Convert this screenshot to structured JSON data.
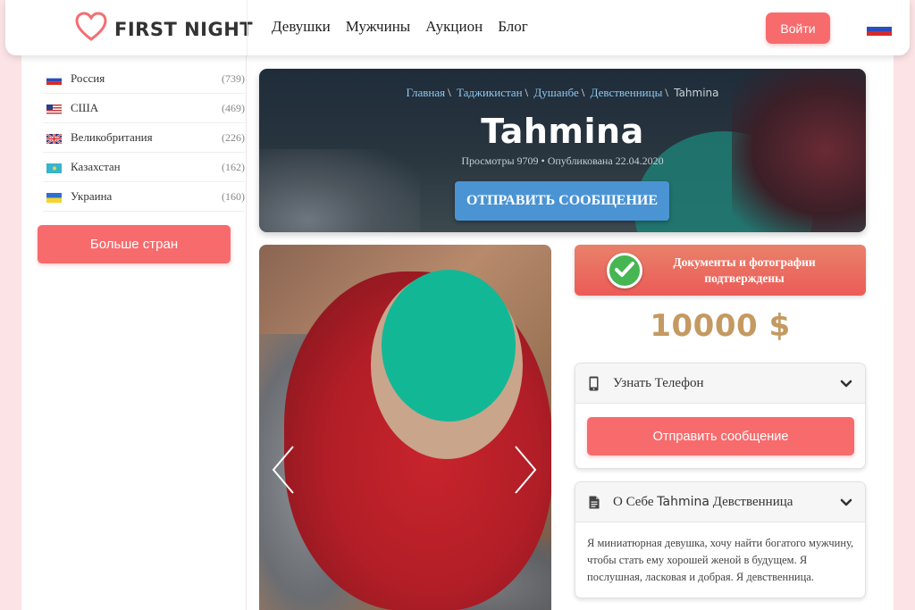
{
  "header": {
    "logo_text": "FIRST NIGHT",
    "nav": [
      "Девушки",
      "Мужчины",
      "Аукцион",
      "Блог"
    ],
    "login_label": "Войти",
    "language_flag": "russia-flag-icon"
  },
  "sidebar": {
    "countries": [
      {
        "name": "Россия",
        "count": "(739)",
        "flag": "russia-flag-icon"
      },
      {
        "name": "США",
        "count": "(469)",
        "flag": "usa-flag-icon"
      },
      {
        "name": "Великобритания",
        "count": "(226)",
        "flag": "uk-flag-icon"
      },
      {
        "name": "Казахстан",
        "count": "(162)",
        "flag": "kazakhstan-flag-icon"
      },
      {
        "name": "Украина",
        "count": "(160)",
        "flag": "ukraine-flag-icon"
      }
    ],
    "more_label": "Больше стран"
  },
  "hero": {
    "breadcrumb": [
      "Главная",
      "Таджикистан",
      "Душанбе",
      "Девственницы"
    ],
    "breadcrumb_sep": "\\",
    "breadcrumb_current": "Tahmina",
    "title": "Tahmina",
    "meta": "Просмотры 9709 • Опубликована 22.04.2020",
    "send_label": "ОТПРАВИТЬ СООБЩЕНИЕ"
  },
  "verified": {
    "line1": "Документы и фотографии",
    "line2": "подтверждены"
  },
  "price": "10000 $",
  "phone_panel": {
    "title": "Узнать Телефон",
    "button_label": "Отправить сообщение"
  },
  "about_panel": {
    "title_prefix": "О Себе",
    "title_name": "Tahmina",
    "title_suffix": "Девственница",
    "text": "Я миниатюрная девушка, хочу найти богатого мужчину, чтобы стать ему хорошей женой в будущем. Я послушная, ласковая и добрая. Я девственница."
  },
  "colors": {
    "accent": "#f76b6d",
    "hero_button": "#4a94d4",
    "price": "#c49a62",
    "verified_check": "#46b653"
  }
}
